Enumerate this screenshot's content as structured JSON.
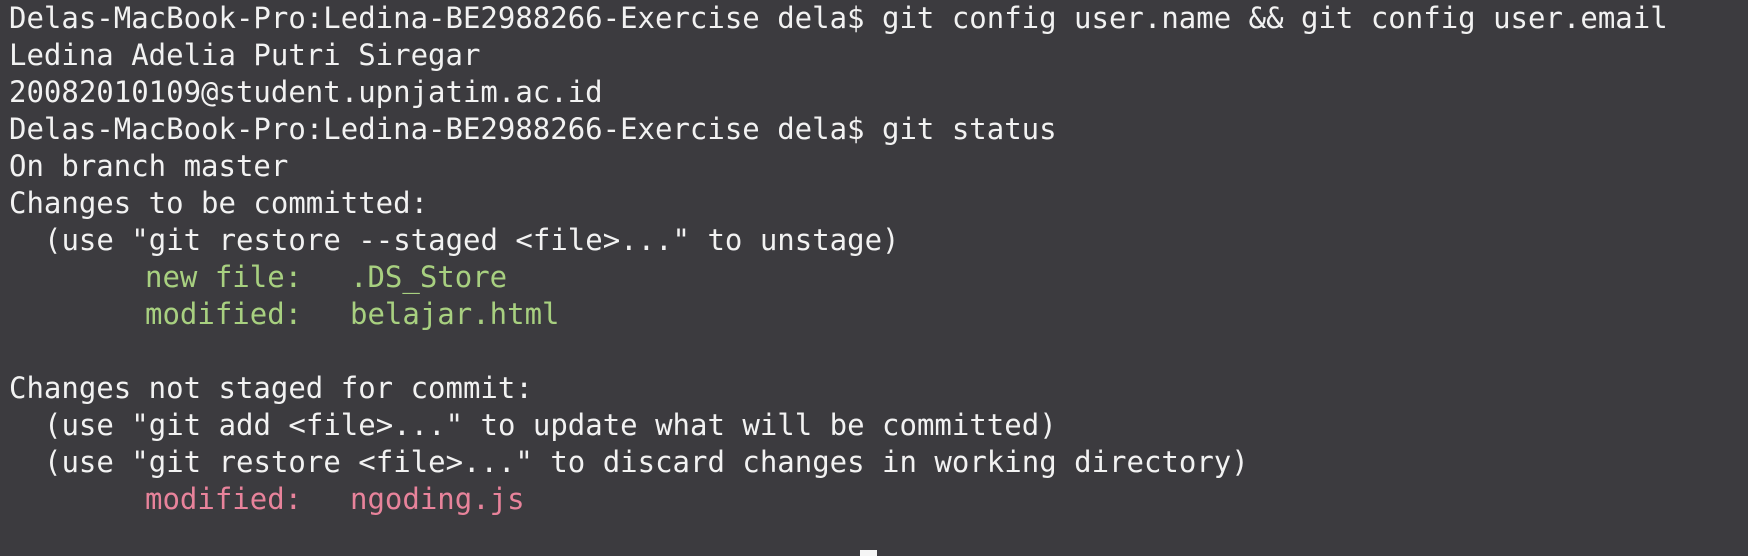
{
  "terminal": {
    "lines": [
      {
        "type": "command",
        "prompt": "Delas-MacBook-Pro:Ledina-BE2988266-Exercise dela$",
        "command": "git config user.name && git config user.email"
      },
      {
        "type": "output",
        "text": "Ledina Adelia Putri Siregar"
      },
      {
        "type": "output",
        "text": "20082010109@student.upnjatim.ac.id"
      },
      {
        "type": "command",
        "prompt": "Delas-MacBook-Pro:Ledina-BE2988266-Exercise dela$",
        "command": "git status"
      },
      {
        "type": "output",
        "text": "On branch master"
      },
      {
        "type": "output",
        "text": "Changes to be committed:"
      },
      {
        "type": "hint",
        "text": "(use \"git restore --staged <file>...\" to unstage)"
      },
      {
        "type": "staged",
        "label": "new file:",
        "file": ".DS_Store"
      },
      {
        "type": "staged",
        "label": "modified:",
        "file": "belajar.html"
      },
      {
        "type": "blank",
        "text": ""
      },
      {
        "type": "output",
        "text": "Changes not staged for commit:"
      },
      {
        "type": "hint",
        "text": "(use \"git add <file>...\" to update what will be committed)"
      },
      {
        "type": "hint",
        "text": "(use \"git restore <file>...\" to discard changes in working directory)"
      },
      {
        "type": "unstaged",
        "label": "modified:",
        "file": "ngoding.js"
      }
    ],
    "colors": {
      "background": "#3c3b3f",
      "foreground": "#f2f2f2",
      "staged": "#a8d080",
      "unstaged": "#e8839b"
    }
  }
}
